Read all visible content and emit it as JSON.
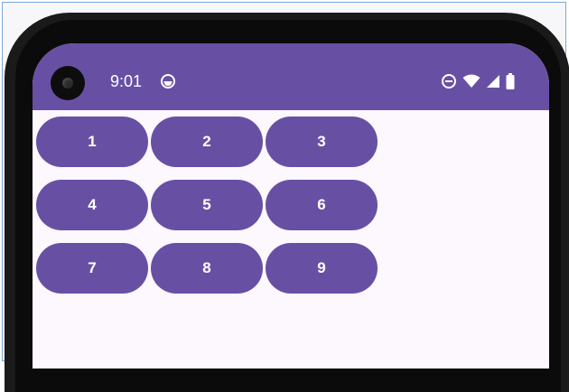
{
  "status_bar": {
    "time": "9:01",
    "background_color": "#6750a4",
    "icons": [
      "camera-cutout",
      "notification-icon",
      "do-not-disturb-icon",
      "wifi-icon",
      "cellular-signal-icon",
      "battery-icon"
    ]
  },
  "buttons": [
    {
      "label": "1"
    },
    {
      "label": "2"
    },
    {
      "label": "3"
    },
    {
      "label": "4"
    },
    {
      "label": "5"
    },
    {
      "label": "6"
    },
    {
      "label": "7"
    },
    {
      "label": "8"
    },
    {
      "label": "9"
    }
  ],
  "colors": {
    "accent": "#6750a4",
    "screen_background": "#fdf8fd",
    "button_text": "#ffffff"
  }
}
